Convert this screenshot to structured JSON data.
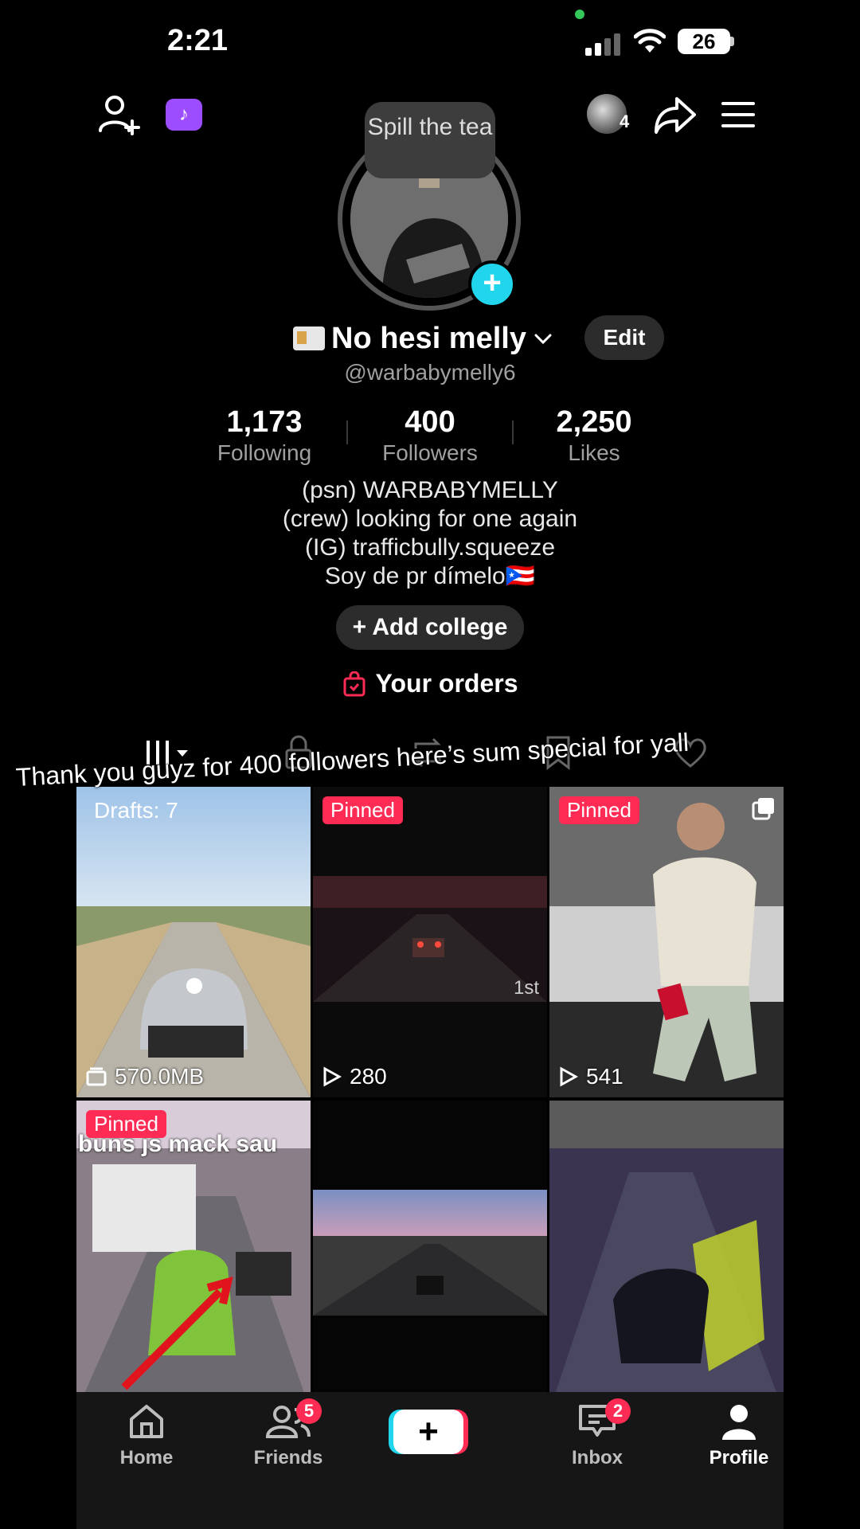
{
  "status_bar": {
    "time": "2:21",
    "battery": "26"
  },
  "top_bar": {
    "story_count": "4"
  },
  "avatar": {
    "bubble_text": "Spill the tea"
  },
  "profile": {
    "display_name": "No hesi melly",
    "edit_label": "Edit",
    "username": "@warbabymelly6"
  },
  "stats": [
    {
      "value": "1,173",
      "label": "Following"
    },
    {
      "value": "400",
      "label": "Followers"
    },
    {
      "value": "2,250",
      "label": "Likes"
    }
  ],
  "bio": [
    "(psn) WARBABYMELLY",
    "(crew) looking for one again",
    "(IG) trafficbully.squeeze",
    "Soy de pr dímelo🇵🇷"
  ],
  "add_college_label": "Add college",
  "orders_label": "Your orders",
  "caption_overlay": "Thank you guyz for 400 followers here’s sum special for yall",
  "grid": [
    {
      "badge": "Drafts: 7",
      "stat": "570.0MB",
      "stat_icon": "drafts-icon"
    },
    {
      "badge": "Pinned",
      "stat": "280",
      "stat_icon": "play-icon",
      "rank_text": "1st"
    },
    {
      "badge": "Pinned",
      "stat": "541",
      "stat_icon": "play-icon"
    },
    {
      "badge": "Pinned",
      "overlay_text": "buns js mack sau",
      "stat": "",
      "stat_icon": "play-icon"
    },
    {
      "badge": "",
      "stat": "",
      "stat_icon": "play-icon"
    },
    {
      "badge": "",
      "stat": "",
      "stat_icon": "play-icon"
    }
  ],
  "bottom_nav": {
    "home": "Home",
    "friends": "Friends",
    "friends_badge": "5",
    "inbox": "Inbox",
    "inbox_badge": "2",
    "profile": "Profile"
  },
  "colors": {
    "accent_red": "#fe2c55",
    "accent_cyan": "#20d5ec",
    "badge_purple": "#9b4dff"
  }
}
